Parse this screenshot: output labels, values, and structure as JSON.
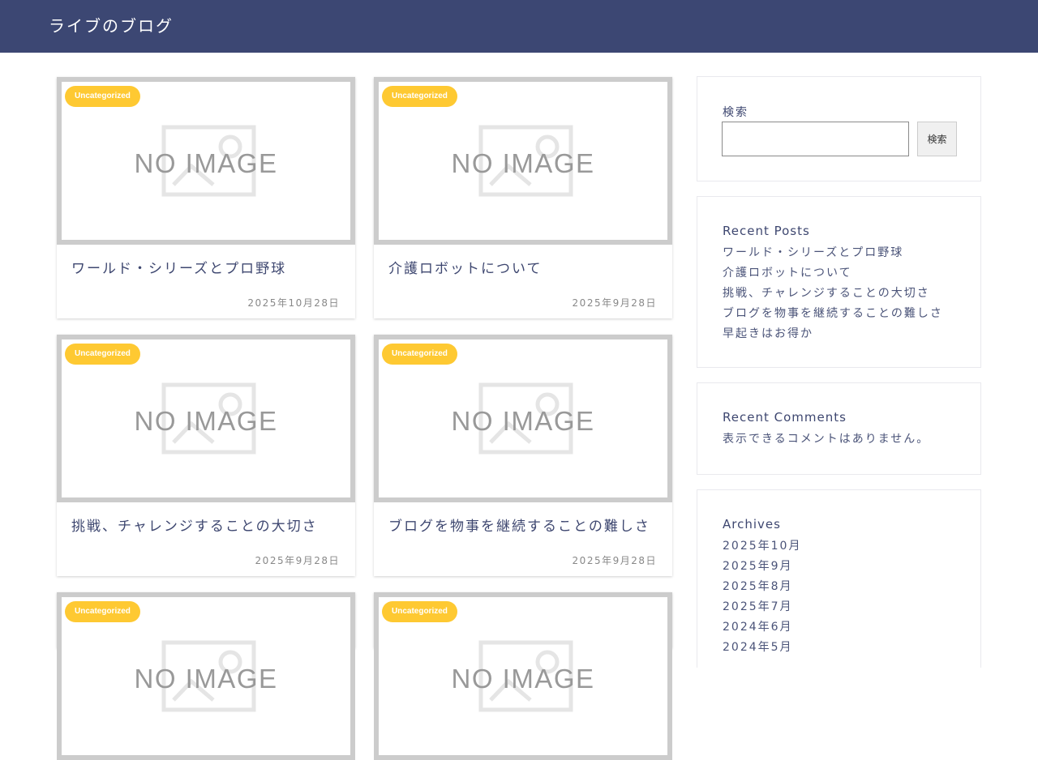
{
  "header": {
    "site_title": "ライブのブログ"
  },
  "posts": [
    {
      "category": "Uncategorized",
      "thumbnail_text": "NO IMAGE",
      "title": "ワールド・シリーズとプロ野球",
      "date": "2025年10月28日"
    },
    {
      "category": "Uncategorized",
      "thumbnail_text": "NO IMAGE",
      "title": "介護ロボットについて",
      "date": "2025年9月28日"
    },
    {
      "category": "Uncategorized",
      "thumbnail_text": "NO IMAGE",
      "title": "挑戦、チャレンジすることの大切さ",
      "date": "2025年9月28日"
    },
    {
      "category": "Uncategorized",
      "thumbnail_text": "NO IMAGE",
      "title": "ブログを物事を継続することの難しさ",
      "date": "2025年9月28日"
    },
    {
      "category": "Uncategorized",
      "thumbnail_text": "NO IMAGE"
    },
    {
      "category": "Uncategorized",
      "thumbnail_text": "NO IMAGE"
    }
  ],
  "sidebar": {
    "search": {
      "label": "検索",
      "button_label": "検索",
      "value": ""
    },
    "recent_posts": {
      "title": "Recent Posts",
      "items": [
        "ワールド・シリーズとプロ野球",
        "介護ロボットについて",
        "挑戦、チャレンジすることの大切さ",
        "ブログを物事を継続することの難しさ",
        "早起きはお得か"
      ]
    },
    "recent_comments": {
      "title": "Recent Comments",
      "empty_text": "表示できるコメントはありません。"
    },
    "archives": {
      "title": "Archives",
      "items": [
        "2025年10月",
        "2025年9月",
        "2025年8月",
        "2025年7月",
        "2024年6月",
        "2024年5月"
      ]
    }
  },
  "colors": {
    "header_bg": "#3c4773",
    "badge_bg": "#fec932",
    "thumb_border": "#cccccc",
    "text": "#4a5378"
  }
}
